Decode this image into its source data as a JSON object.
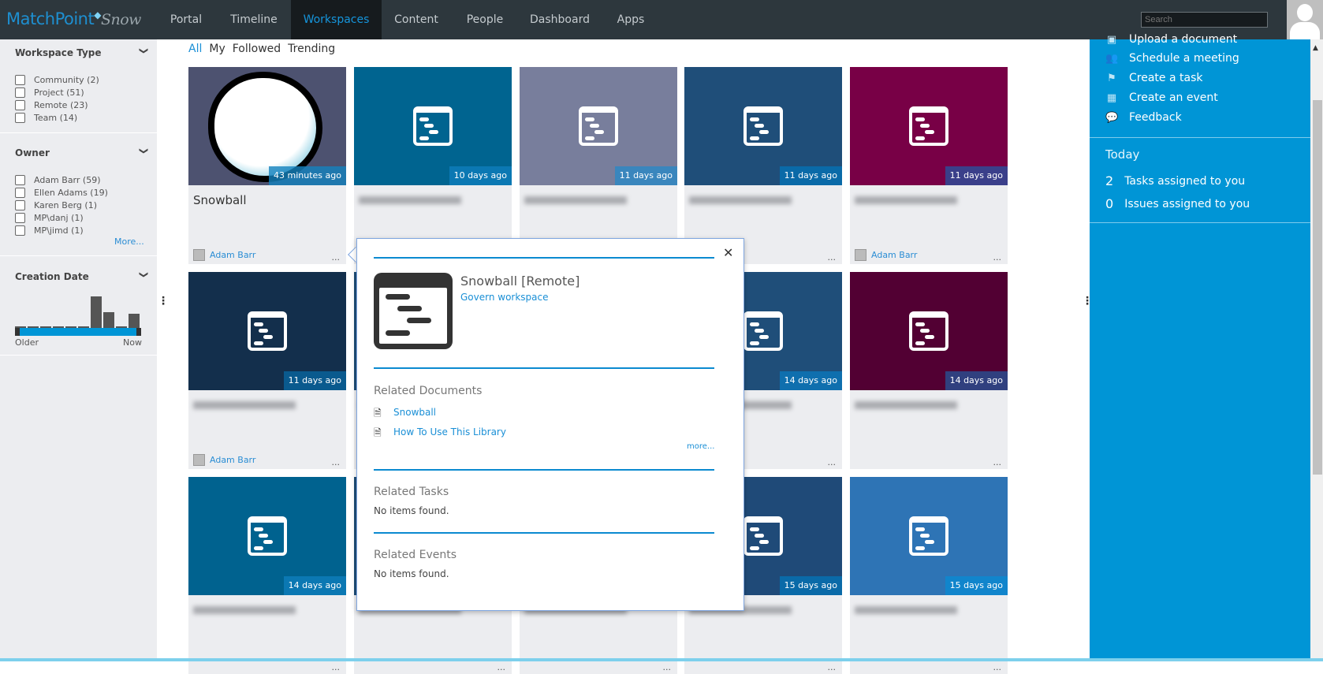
{
  "header": {
    "logo_main": "MatchPoint",
    "logo_suffix": "Snow",
    "nav": [
      {
        "label": "Portal"
      },
      {
        "label": "Timeline"
      },
      {
        "label": "Workspaces",
        "active": true
      },
      {
        "label": "Content"
      },
      {
        "label": "People"
      },
      {
        "label": "Dashboard"
      },
      {
        "label": "Apps"
      }
    ],
    "search_placeholder": "Search"
  },
  "sidebar": {
    "workspace_type": {
      "title": "Workspace Type",
      "items": [
        "Community (2)",
        "Project (51)",
        "Remote (23)",
        "Team (14)"
      ]
    },
    "owner": {
      "title": "Owner",
      "items": [
        "Adam Barr (59)",
        "Ellen Adams (19)",
        "Karen Berg (1)",
        "MP\\danj (1)",
        "MP\\jimd (1)"
      ],
      "more": "More..."
    },
    "creation_date": {
      "title": "Creation Date",
      "histogram": [
        0.05,
        0.05,
        0.05,
        0.05,
        0.05,
        0.05,
        1,
        0.5,
        0.05,
        0.45
      ],
      "older": "Older",
      "now": "Now"
    }
  },
  "filters": [
    {
      "label": "All",
      "active": true
    },
    {
      "label": "My"
    },
    {
      "label": "Followed"
    },
    {
      "label": "Trending"
    }
  ],
  "tiles": [
    {
      "color": "#4d5270",
      "badge": "43 minutes ago",
      "badge_color": "rgba(20,130,190,.8)",
      "name": "Snowball",
      "owner": "Adam Barr",
      "snowball": true
    },
    {
      "color": "#006490",
      "badge": "10 days ago",
      "badge_color": "#0b78b3"
    },
    {
      "color": "#787e9c",
      "badge": "11 days ago",
      "badge_color": "#3a86bd"
    },
    {
      "color": "#1f4e79",
      "badge": "11 days ago",
      "badge_color": "#0a6aa8"
    },
    {
      "color": "#780046",
      "badge": "11 days ago",
      "badge_color": "#3a3f8a",
      "owner": "Adam Barr"
    },
    {
      "color": "#132f4c",
      "badge": "11 days ago",
      "badge_color": "#0a5a8e",
      "owner": "Adam Barr"
    },
    {
      "color": "#1f4e79",
      "badge": "",
      "badge_color": "#0a6aa8"
    },
    {
      "color": "#1f4e79",
      "badge": "",
      "badge_color": "#0a6aa8"
    },
    {
      "color": "#1f4e79",
      "badge": "14 days ago",
      "badge_color": "#0f6fae"
    },
    {
      "color": "#520033",
      "badge": "14 days ago",
      "badge_color": "#30407f"
    },
    {
      "color": "#00628f",
      "badge": "14 days ago",
      "badge_color": "#0b78b3"
    },
    {
      "color": "#1f4e79",
      "badge": "",
      "badge_color": "#0a6aa8"
    },
    {
      "color": "#1f4e79",
      "badge": "",
      "badge_color": "#0a6aa8"
    },
    {
      "color": "#1f4a78",
      "badge": "15 days ago",
      "badge_color": "#0a6aa8"
    },
    {
      "color": "#2e74b5",
      "badge": "15 days ago",
      "badge_color": "#1185cc"
    }
  ],
  "popup": {
    "title": "Snowball [Remote]",
    "govern": "Govern workspace",
    "docs_title": "Related Documents",
    "docs": [
      "Snowball",
      "How To Use This Library"
    ],
    "more": "more...",
    "tasks_title": "Related Tasks",
    "tasks_empty": "No items found.",
    "events_title": "Related Events",
    "events_empty": "No items found."
  },
  "right_panel": {
    "actions": [
      {
        "label": "Upload a document",
        "icon": "upload-icon"
      },
      {
        "label": "Schedule a meeting",
        "icon": "people-icon"
      },
      {
        "label": "Create a task",
        "icon": "flag-icon"
      },
      {
        "label": "Create an event",
        "icon": "calendar-icon"
      },
      {
        "label": "Feedback",
        "icon": "feedback-icon"
      }
    ],
    "today_title": "Today",
    "today": [
      {
        "count": "2",
        "label": "Tasks assigned to you"
      },
      {
        "count": "0",
        "label": "Issues assigned to you"
      }
    ]
  },
  "colors": {
    "accent": "#0095d6",
    "topbar": "#2d373d"
  }
}
